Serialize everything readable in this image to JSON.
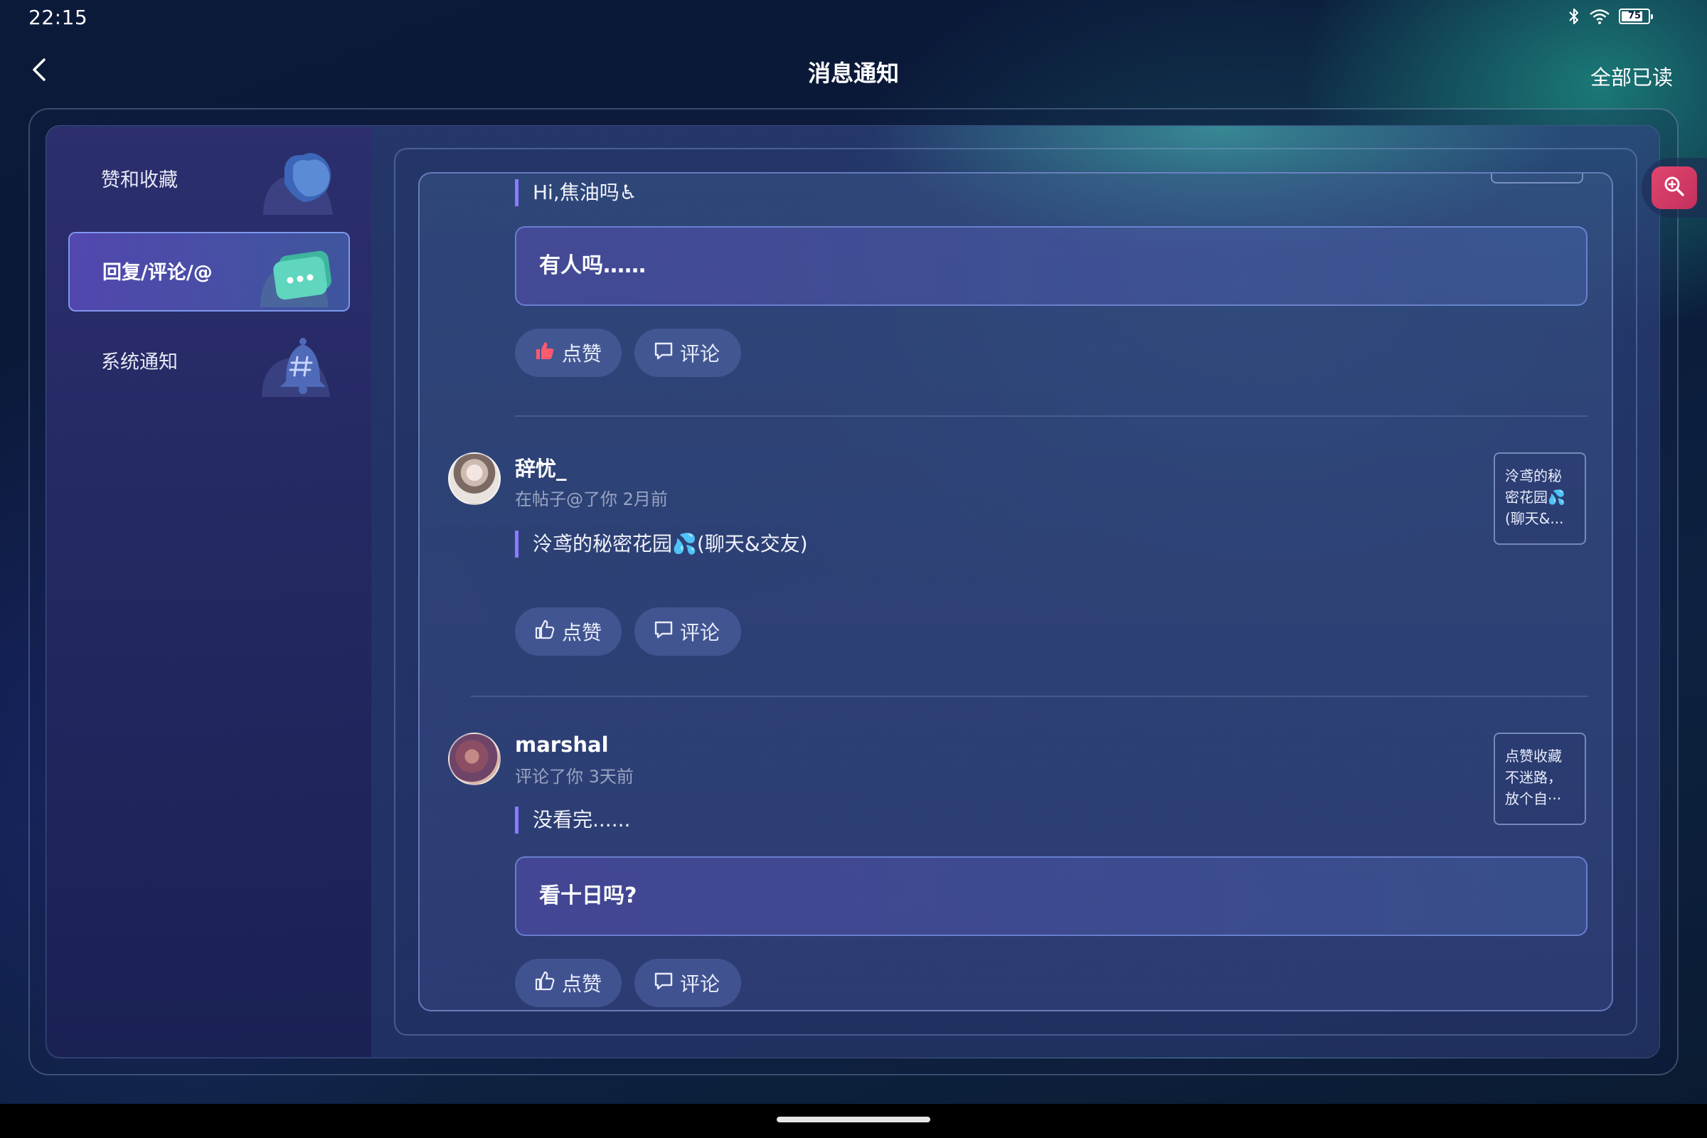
{
  "status_bar": {
    "time": "22:15",
    "battery_level": "75",
    "icons": [
      "bluetooth-icon",
      "wifi-icon",
      "battery-icon"
    ]
  },
  "header": {
    "title": "消息通知",
    "mark_all_read": "全部已读",
    "back_icon": "chevron-left-icon"
  },
  "sidebar": {
    "items": [
      {
        "label": "赞和收藏",
        "icon": "heart-bubble-icon",
        "active": false
      },
      {
        "label": "回复/评论/@",
        "icon": "chat-bubble-icon",
        "active": true
      },
      {
        "label": "系统通知",
        "icon": "bell-hash-icon",
        "active": false
      }
    ]
  },
  "messages": [
    {
      "quote": "Hi,焦油吗♿",
      "reply": "有人吗……",
      "like_label": "点赞",
      "like_active": true,
      "comment_label": "评论"
    },
    {
      "user": "辞忧_",
      "meta": "在帖子@了你 2月前",
      "quote": "泠鸢的秘密花园💦(聊天&交友)",
      "thumbnail_text": "泠鸢的秘密花园💦(聊天&...",
      "like_label": "点赞",
      "like_active": false,
      "comment_label": "评论"
    },
    {
      "user": "marshal",
      "meta": "评论了你 3天前",
      "quote": "没看完......",
      "reply": "看十日吗?",
      "thumbnail_text": "点赞收藏不迷路，放个自···",
      "like_label": "点赞",
      "like_active": false,
      "comment_label": "评论"
    }
  ],
  "floating_action": {
    "icon": "zoom-in-icon"
  },
  "colors": {
    "accent_purple": "#8a7bff",
    "like_active": "#ff5a6e",
    "float_button": "#d63a66"
  }
}
